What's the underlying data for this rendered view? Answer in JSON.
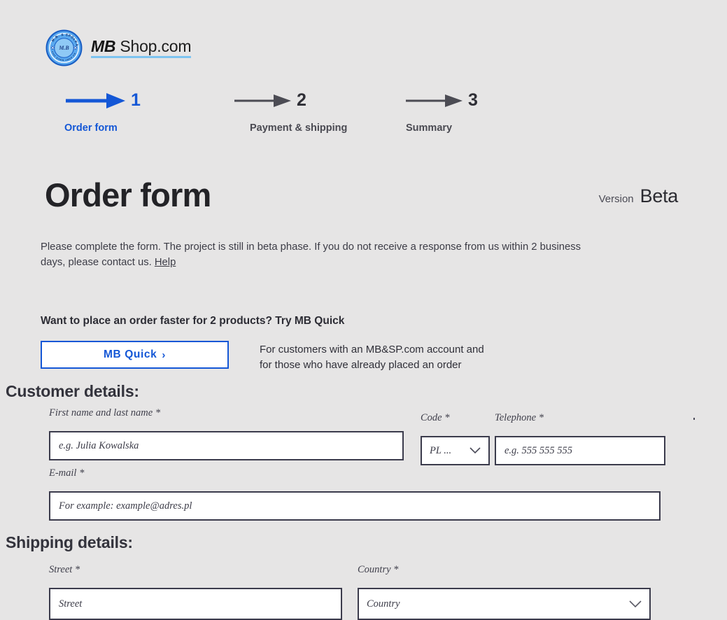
{
  "brand": {
    "logo_icon": "mb-circular-badge-logo",
    "mark_bold": "MB",
    "mark_rest": " Shop.com",
    "badge_top_text": "M.B. & SPÓŁKA",
    "badge_center_text": "M.B",
    "badge_bottom_text": "DO GÓRY SINCE 2013",
    "accent_color": "#1457d6",
    "underline_color": "#7dc4f0"
  },
  "stepper": {
    "steps": [
      {
        "number": "1",
        "label": "Order form",
        "state": "active",
        "arrow_icon": "arrow-right-icon"
      },
      {
        "number": "2",
        "label": "Payment & shipping",
        "state": "inactive",
        "arrow_icon": "arrow-right-icon"
      },
      {
        "number": "3",
        "label": "Summary",
        "state": "inactive",
        "arrow_icon": "arrow-right-icon"
      }
    ]
  },
  "header": {
    "title": "Order form",
    "version_label": "Version",
    "version_value": "Beta"
  },
  "intro": {
    "text": "Please complete the form. The project is still in beta phase. If you do not receive a response from us within 2 business days, please contact us. ",
    "help_link": "Help"
  },
  "promo": {
    "heading": "Want to place an order faster for 2 products? Try MB Quick",
    "button_label": "MB Quick",
    "button_chevron": "›",
    "description_line1": "For customers with an MB&SP.com account and",
    "description_line2": "for those who have already placed an order"
  },
  "customer_section": {
    "heading": "Customer details:",
    "fields": {
      "name": {
        "label": "First name and last name *",
        "placeholder": "e.g. Julia Kowalska",
        "value": ""
      },
      "code": {
        "label": "Code *",
        "selected": "PL ...",
        "chevron_icon": "chevron-down-icon"
      },
      "phone": {
        "label": "Telephone *",
        "placeholder": "e.g. 555 555 555",
        "value": ""
      },
      "email": {
        "label": "E-mail *",
        "placeholder": "For example: example@adres.pl",
        "value": ""
      }
    }
  },
  "shipping_section": {
    "heading": "Shipping details:",
    "fields": {
      "street": {
        "label": "Street *",
        "placeholder": "Street",
        "value": ""
      },
      "country": {
        "label": "Country *",
        "selected": "Country",
        "chevron_icon": "chevron-down-icon"
      }
    }
  },
  "colors": {
    "page_background": "#e6e5e5",
    "field_border": "#3b3b4c",
    "text_primary": "#33333c",
    "link_blue": "#1457d6"
  }
}
